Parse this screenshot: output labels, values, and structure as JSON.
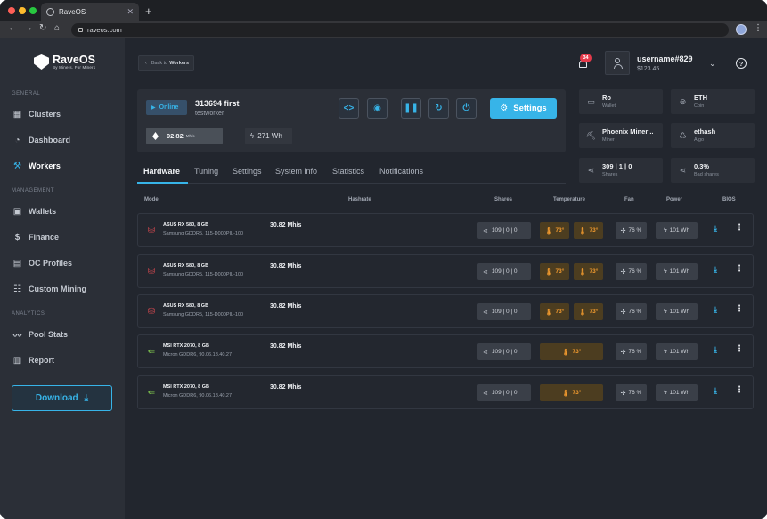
{
  "browser": {
    "tab_title": "RaveOS",
    "url": "raveos.com"
  },
  "brand": {
    "name": "RaveOS",
    "tagline": "By Miners. For Miners",
    "accent_color": "#37b4e8"
  },
  "sidebar": {
    "sections": {
      "general": "GENERAL",
      "management": "MANAGEMENT",
      "analytics": "ANALYTICS"
    },
    "items": [
      {
        "label": "Clusters",
        "icon": "grid-icon"
      },
      {
        "label": "Dashboard",
        "icon": "speedometer-icon"
      },
      {
        "label": "Workers",
        "icon": "pickaxe-icon",
        "active": true
      },
      {
        "label": "Wallets",
        "icon": "wallet-icon"
      },
      {
        "label": "Finance",
        "icon": "dollar-icon"
      },
      {
        "label": "OC Profiles",
        "icon": "oc-profile-icon"
      },
      {
        "label": "Custom Mining",
        "icon": "sliders-icon"
      },
      {
        "label": "Pool Stats",
        "icon": "trend-line-icon"
      },
      {
        "label": "Report",
        "icon": "report-icon"
      }
    ],
    "download_label": "Download"
  },
  "header": {
    "back_label": "Back to",
    "back_target": "Workers",
    "notification_count": "34",
    "username": "username#829",
    "balance": "$123.45"
  },
  "worker": {
    "status": "Online",
    "name": "313694 first",
    "subname": "testworker",
    "hashrate": "92.82",
    "hashrate_unit": "Mh/s",
    "power": "271 Wh",
    "settings_label": "Settings"
  },
  "info_tiles": [
    {
      "value": "Ro",
      "label": "Wallet",
      "icon": "wallet-icon"
    },
    {
      "value": "ETH",
      "label": "Coin",
      "icon": "coin-icon"
    },
    {
      "value": "Phoenix Miner ..",
      "label": "Miner",
      "icon": "pickaxe-icon"
    },
    {
      "value": "ethash",
      "label": "Algo",
      "icon": "algo-icon"
    },
    {
      "value": "309 | 1 | 0",
      "label": "Shares",
      "icon": "share-icon"
    },
    {
      "value": "0.3%",
      "label": "Bad shares",
      "icon": "share-icon"
    }
  ],
  "tabs": [
    "Hardware",
    "Tuning",
    "Settings",
    "System info",
    "Statistics",
    "Notifications"
  ],
  "table": {
    "headers": {
      "model": "Model",
      "hashrate": "Hashrate",
      "shares": "Shares",
      "temperature": "Temperature",
      "fan": "Fan",
      "power": "Power",
      "bios": "BIOS"
    },
    "rows": [
      {
        "brand": "amd",
        "model": "ASUS RX 580, 8 GB",
        "memory": "Samsung GDDR5, 115-D000PIL-100",
        "hashrate": "30.82 Mh/s",
        "shares": "109 | 0 | 0",
        "temps": [
          "73°",
          "73°"
        ],
        "fan": "76 %",
        "power": "101 Wh"
      },
      {
        "brand": "amd",
        "model": "ASUS RX 580, 8 GB",
        "memory": "Samsung GDDR5, 115-D000PIL-100",
        "hashrate": "30.82 Mh/s",
        "shares": "109 | 0 | 0",
        "temps": [
          "73°",
          "73°"
        ],
        "fan": "76 %",
        "power": "101 Wh"
      },
      {
        "brand": "amd",
        "model": "ASUS RX 580, 8 GB",
        "memory": "Samsung GDDR5, 115-D000PIL-100",
        "hashrate": "30.82 Mh/s",
        "shares": "109 | 0 | 0",
        "temps": [
          "73°",
          "73°"
        ],
        "fan": "76 %",
        "power": "101 Wh"
      },
      {
        "brand": "nvidia",
        "model": "MSI RTX 2070, 8 GB",
        "memory": "Micron GDDR6, 90.06.18.40.27",
        "hashrate": "30.82 Mh/s",
        "shares": "109 | 0 | 0",
        "temps": [
          "73°"
        ],
        "fan": "76 %",
        "power": "101 Wh"
      },
      {
        "brand": "nvidia",
        "model": "MSI RTX 2070, 8 GB",
        "memory": "Micron GDDR6, 90.06.18.40.27",
        "hashrate": "30.82 Mh/s",
        "shares": "109 | 0 | 0",
        "temps": [
          "73°"
        ],
        "fan": "76 %",
        "power": "101 Wh"
      }
    ]
  },
  "colors": {
    "amd": "#d2484f",
    "nvidia": "#7ec34e",
    "temp_warn": "#f29a2e"
  }
}
